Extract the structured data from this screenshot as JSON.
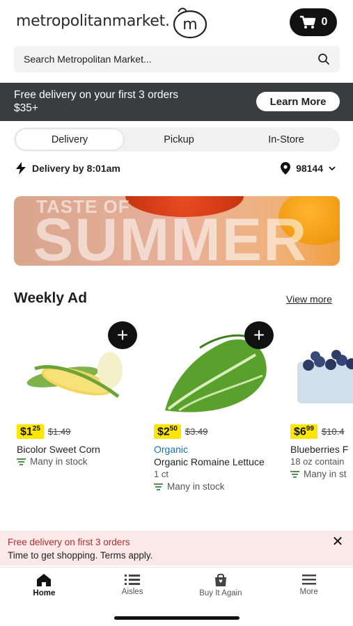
{
  "header": {
    "brand": "metropolitanmarket",
    "brand_mark": ".",
    "logo_text": "m",
    "cart_count": "0"
  },
  "search": {
    "placeholder": "Search Metropolitan Market..."
  },
  "promo": {
    "text_line1": "Free delivery on your first 3 orders",
    "text_line2": "$35+",
    "button": "Learn More"
  },
  "segment": {
    "items": [
      "Delivery",
      "Pickup",
      "In-Store"
    ],
    "active": "Delivery"
  },
  "info": {
    "delivery": "Delivery by 8:01am",
    "zip": "98144"
  },
  "hero": {
    "line1": "TASTE OF",
    "line2": "SUMMER"
  },
  "weekly_ad": {
    "title": "Weekly Ad",
    "view_more": "View more",
    "products": [
      {
        "price_main": "$1",
        "price_cents": "25",
        "was": "$1.49",
        "tag": "",
        "name": "Bicolor Sweet Corn",
        "size": "",
        "stock": "Many in stock"
      },
      {
        "price_main": "$2",
        "price_cents": "50",
        "was": "$3.49",
        "tag": "Organic",
        "name": "Organic Romaine Lettuce",
        "size": "1 ct",
        "stock": "Many in stock"
      },
      {
        "price_main": "$6",
        "price_cents": "99",
        "was": "$10.4",
        "tag": "",
        "name": "Blueberries F",
        "size": "18 oz contain",
        "stock": "Many in st"
      }
    ]
  },
  "toast": {
    "title": "Free delivery on first 3 orders",
    "body": "Time to get shopping. Terms apply."
  },
  "tabbar": {
    "items": [
      "Home",
      "Aisles",
      "Buy It Again",
      "More"
    ],
    "active": "Home"
  },
  "colors": {
    "promo_bg": "#3b3c3e",
    "price_tag": "#ffe600",
    "organic": "#1a6fb3",
    "toast_bg": "#fbe8e8",
    "toast_title": "#b03030"
  }
}
